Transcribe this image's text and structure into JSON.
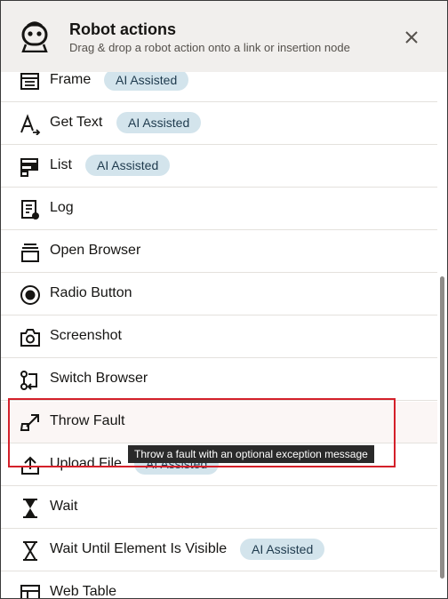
{
  "header": {
    "title": "Robot actions",
    "subtitle": "Drag & drop a robot action onto a link or insertion node",
    "icon": "robot-icon",
    "close_icon": "close-icon"
  },
  "items": [
    {
      "label": "Frame",
      "icon": "frame-icon",
      "badge": "AI Assisted"
    },
    {
      "label": "Get Text",
      "icon": "get-text-icon",
      "badge": "AI Assisted"
    },
    {
      "label": "List",
      "icon": "list-icon",
      "badge": "AI Assisted"
    },
    {
      "label": "Log",
      "icon": "log-icon"
    },
    {
      "label": "Open Browser",
      "icon": "open-browser-icon"
    },
    {
      "label": "Radio Button",
      "icon": "radio-button-icon"
    },
    {
      "label": "Screenshot",
      "icon": "camera-icon"
    },
    {
      "label": "Switch Browser",
      "icon": "switch-browser-icon"
    },
    {
      "label": "Throw Fault",
      "icon": "throw-fault-icon",
      "selected": true
    },
    {
      "label": "Upload File",
      "icon": "upload-icon",
      "badge": "AI Assisted"
    },
    {
      "label": "Wait",
      "icon": "hourglass-icon"
    },
    {
      "label": "Wait Until Element Is Visible",
      "icon": "hourglass-icon",
      "badge": "AI Assisted"
    },
    {
      "label": "Web Table",
      "icon": "web-table-icon"
    }
  ],
  "tooltip": "Throw a fault with an optional exception message",
  "colors": {
    "badge_bg": "#d3e4ec",
    "highlight": "#d4202a",
    "header_bg": "#f1efed"
  }
}
